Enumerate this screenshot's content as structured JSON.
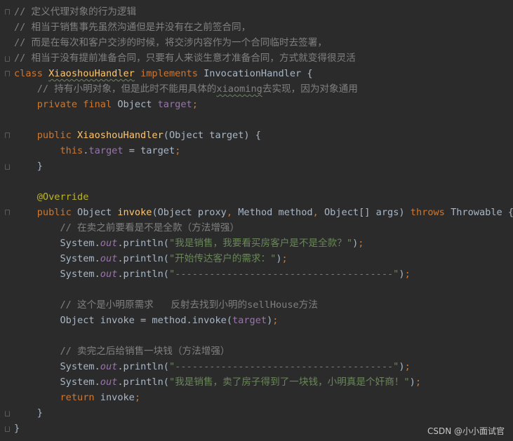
{
  "editor": {
    "lines": [
      [
        {
          "t": "// 定义代理对象的行为逻辑",
          "c": "comment"
        }
      ],
      [
        {
          "t": "// 相当于销售事先虽然沟通但是并没有在之前签合同，",
          "c": "comment"
        }
      ],
      [
        {
          "t": "// 而是在每次和客户交涉的时候，将交涉内容作为一个合同临时去签署，",
          "c": "comment"
        }
      ],
      [
        {
          "t": "// 相当于没有提前准备合同，只要有人来谈生意才准备合同，方式就变得很灵活",
          "c": "comment"
        }
      ],
      [
        {
          "t": "class ",
          "c": "kw"
        },
        {
          "t": "XiaoshouHandler",
          "c": "cls typo"
        },
        {
          "t": " ",
          "c": "txt"
        },
        {
          "t": "implements",
          "c": "kw"
        },
        {
          "t": " InvocationHandler {",
          "c": "txt"
        }
      ],
      [
        {
          "t": "    // 持有小明对象，但是此时不能用具体的",
          "c": "comment"
        },
        {
          "t": "xiaoming",
          "c": "comment typo"
        },
        {
          "t": "去实现，因为对象通用",
          "c": "comment"
        }
      ],
      [
        {
          "t": "    private final ",
          "c": "kw"
        },
        {
          "t": "Object ",
          "c": "txt"
        },
        {
          "t": "target",
          "c": "field"
        },
        {
          "t": ";",
          "c": "punct"
        }
      ],
      [],
      [
        {
          "t": "    public ",
          "c": "kw"
        },
        {
          "t": "XiaoshouHandler",
          "c": "method"
        },
        {
          "t": "(Object target) {",
          "c": "txt"
        }
      ],
      [
        {
          "t": "        this",
          "c": "kw"
        },
        {
          "t": ".",
          "c": "txt"
        },
        {
          "t": "target",
          "c": "field"
        },
        {
          "t": " = target",
          "c": "txt"
        },
        {
          "t": ";",
          "c": "punct"
        }
      ],
      [
        {
          "t": "    }",
          "c": "txt"
        }
      ],
      [],
      [
        {
          "t": "    @Override",
          "c": "ann"
        }
      ],
      [
        {
          "t": "    public ",
          "c": "kw"
        },
        {
          "t": "Object ",
          "c": "txt"
        },
        {
          "t": "invoke",
          "c": "method"
        },
        {
          "t": "(Object proxy",
          "c": "txt"
        },
        {
          "t": ", ",
          "c": "punct"
        },
        {
          "t": "Method method",
          "c": "txt"
        },
        {
          "t": ", ",
          "c": "punct"
        },
        {
          "t": "Object[] args) ",
          "c": "txt"
        },
        {
          "t": "throws ",
          "c": "kw"
        },
        {
          "t": "Throwable {",
          "c": "txt"
        }
      ],
      [
        {
          "t": "        // 在卖之前要看是不是全款（方法增强）",
          "c": "comment"
        }
      ],
      [
        {
          "t": "        System.",
          "c": "txt"
        },
        {
          "t": "out",
          "c": "static-field"
        },
        {
          "t": ".println(",
          "c": "txt"
        },
        {
          "t": "\"我是销售，我要看买房客户是不是全款？\"",
          "c": "str"
        },
        {
          "t": ")",
          "c": "txt"
        },
        {
          "t": ";",
          "c": "punct"
        }
      ],
      [
        {
          "t": "        System.",
          "c": "txt"
        },
        {
          "t": "out",
          "c": "static-field"
        },
        {
          "t": ".println(",
          "c": "txt"
        },
        {
          "t": "\"开始传达客户的需求：\"",
          "c": "str"
        },
        {
          "t": ")",
          "c": "txt"
        },
        {
          "t": ";",
          "c": "punct"
        }
      ],
      [
        {
          "t": "        System.",
          "c": "txt"
        },
        {
          "t": "out",
          "c": "static-field"
        },
        {
          "t": ".println(",
          "c": "txt"
        },
        {
          "t": "\"--------------------------------------\"",
          "c": "str"
        },
        {
          "t": ")",
          "c": "txt"
        },
        {
          "t": ";",
          "c": "punct"
        }
      ],
      [],
      [
        {
          "t": "        // 这个是小明原需求   反射去找到小明的sellHouse方法",
          "c": "comment"
        }
      ],
      [
        {
          "t": "        Object invoke = method.invoke(",
          "c": "txt"
        },
        {
          "t": "target",
          "c": "field"
        },
        {
          "t": ")",
          "c": "txt"
        },
        {
          "t": ";",
          "c": "punct"
        }
      ],
      [],
      [
        {
          "t": "        // 卖完之后给销售一块钱（方法增强）",
          "c": "comment"
        }
      ],
      [
        {
          "t": "        System.",
          "c": "txt"
        },
        {
          "t": "out",
          "c": "static-field"
        },
        {
          "t": ".println(",
          "c": "txt"
        },
        {
          "t": "\"--------------------------------------\"",
          "c": "str"
        },
        {
          "t": ")",
          "c": "txt"
        },
        {
          "t": ";",
          "c": "punct"
        }
      ],
      [
        {
          "t": "        System.",
          "c": "txt"
        },
        {
          "t": "out",
          "c": "static-field"
        },
        {
          "t": ".println(",
          "c": "txt"
        },
        {
          "t": "\"我是销售，卖了房子得到了一块钱，小明真是个奸商！\"",
          "c": "str"
        },
        {
          "t": ")",
          "c": "txt"
        },
        {
          "t": ";",
          "c": "punct"
        }
      ],
      [
        {
          "t": "        return ",
          "c": "kw"
        },
        {
          "t": "invoke",
          "c": "txt"
        },
        {
          "t": ";",
          "c": "punct"
        }
      ],
      [
        {
          "t": "    }",
          "c": "txt"
        }
      ],
      [
        {
          "t": "}",
          "c": "txt"
        }
      ]
    ]
  },
  "watermark": "CSDN @小小面试官",
  "colors": {
    "background": "#2b2b2b",
    "keyword": "#cc7832",
    "method": "#ffc66d",
    "field": "#9876aa",
    "string": "#6a8759",
    "comment": "#808080",
    "annotation": "#bbb529",
    "text": "#a9b7c6"
  },
  "gutter_fold_markers": [
    {
      "line": 1,
      "kind": "open"
    },
    {
      "line": 4,
      "kind": "close"
    },
    {
      "line": 5,
      "kind": "open"
    },
    {
      "line": 9,
      "kind": "open"
    },
    {
      "line": 11,
      "kind": "close"
    },
    {
      "line": 14,
      "kind": "open"
    },
    {
      "line": 27,
      "kind": "close"
    },
    {
      "line": 28,
      "kind": "close"
    }
  ]
}
